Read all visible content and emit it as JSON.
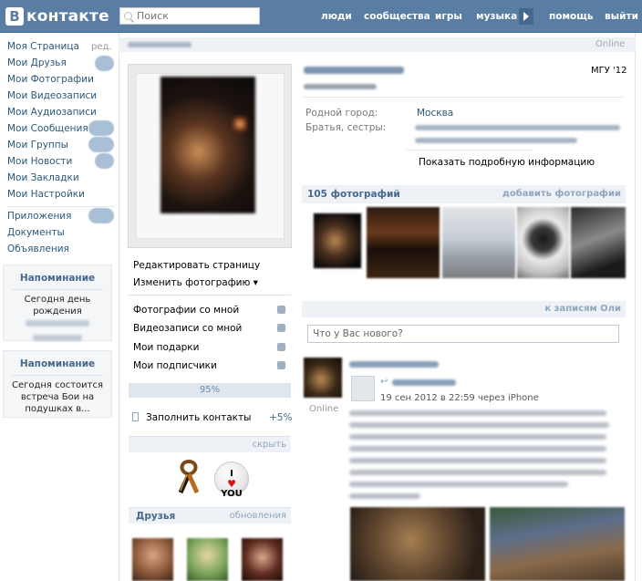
{
  "header": {
    "logo_letter": "В",
    "logo_text": "контакте",
    "search_placeholder": "Поиск",
    "nav": [
      "люди",
      "сообщества",
      "игры",
      "музыка",
      "помощь",
      "выйти"
    ]
  },
  "leftnav": {
    "items": [
      "Моя Страница",
      "Мои Друзья",
      "Мои Фотографии",
      "Мои Видеозаписи",
      "Мои Аудиозаписи",
      "Мои Сообщения",
      "Мои Группы",
      "Мои Новости",
      "Мои Закладки",
      "Мои Настройки",
      "Приложения",
      "Документы",
      "Объявления"
    ],
    "edit_label": "ред."
  },
  "reminders": [
    {
      "title": "Напоминание",
      "text": "Сегодня день рождения"
    },
    {
      "title": "Напоминание",
      "text": "Сегодня состоится встреча Бои на подушках в..."
    }
  ],
  "profile": {
    "online_label": "Online",
    "university": "МГУ '12",
    "hometown_label": "Родной город:",
    "hometown": "Москва",
    "siblings_label": "Братья, сестры:",
    "show_more": "Показать подробную информацию",
    "actions": [
      "Редактировать страницу",
      "Изменить фотографию ▾"
    ],
    "links": [
      "Фотографии со мной",
      "Видеозаписи со мной",
      "Мои подарки",
      "Мои подписчики"
    ],
    "progress": "95%",
    "fill_contacts": "Заполнить контакты",
    "fill_contacts_pct": "+5%",
    "gifts_hide": "скрыть",
    "friends_title": "Друзья",
    "friends_updates": "обновления"
  },
  "photos": {
    "count_label": "105 фотографий",
    "add_label": "добавить фотографии"
  },
  "wall": {
    "to_posts": "к записям Оли",
    "input_placeholder": "Что у Вас нового?",
    "online_label": "Online",
    "post_date": "19 сен 2012 в 22:59 через iPhone"
  },
  "gift_badge": {
    "line1": "I",
    "line2": "YOU"
  },
  "colors": {
    "header": "#597da3",
    "link": "#2b587a",
    "accent_light": "#eef1f5"
  }
}
